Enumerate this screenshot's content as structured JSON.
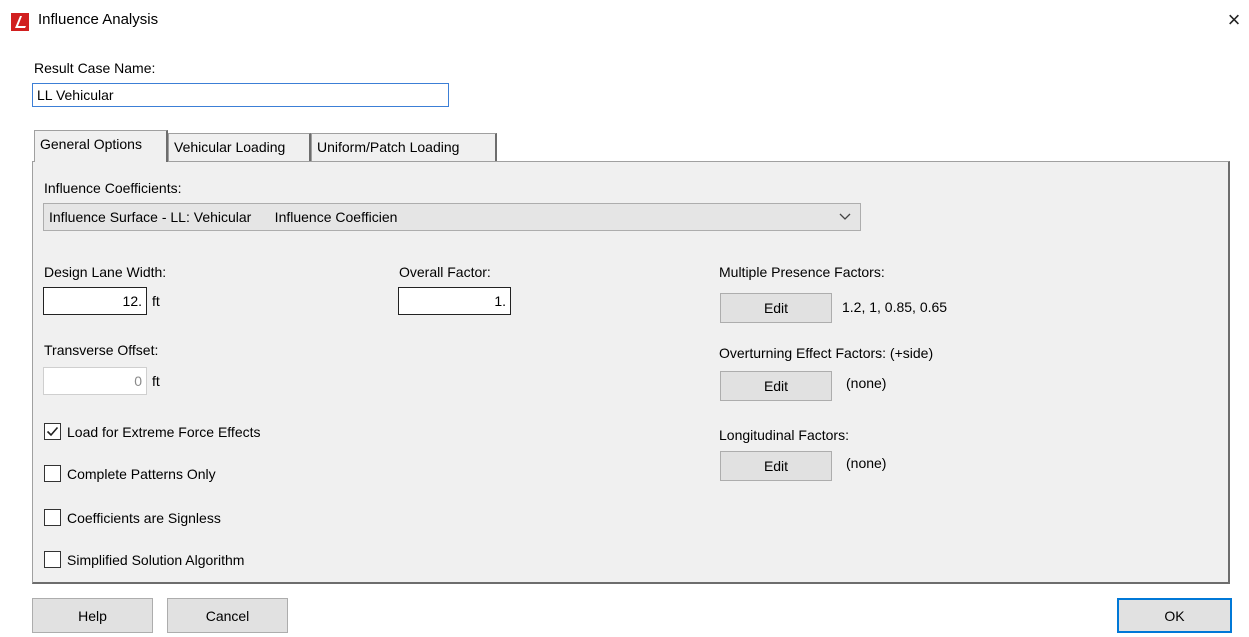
{
  "window": {
    "title": "Influence Analysis",
    "close_label": "×"
  },
  "result_case": {
    "label": "Result Case Name:",
    "value": "LL Vehicular"
  },
  "tabs": [
    {
      "label": "General Options",
      "active": true
    },
    {
      "label": "Vehicular Loading",
      "active": false
    },
    {
      "label": "Uniform/Patch Loading",
      "active": false
    }
  ],
  "general": {
    "influence_label": "Influence Coefficients:",
    "influence_value": "Influence Surface - LL: Vehicular      Influence Coefficien",
    "lane_width_label": "Design Lane Width:",
    "lane_width_value": "12.",
    "lane_width_unit": "ft",
    "overall_factor_label": "Overall Factor:",
    "overall_factor_value": "1.",
    "transverse_offset_label": "Transverse Offset:",
    "transverse_offset_value": "0",
    "transverse_offset_unit": "ft",
    "checkboxes": [
      {
        "label": "Load for Extreme Force Effects",
        "checked": true
      },
      {
        "label": "Complete Patterns Only",
        "checked": false
      },
      {
        "label": "Coefficients are Signless",
        "checked": false
      },
      {
        "label": "Simplified Solution Algorithm",
        "checked": false
      }
    ],
    "multiple_presence_label": "Multiple Presence Factors:",
    "multiple_presence_value": "1.2, 1, 0.85, 0.65",
    "overturning_label": "Overturning Effect Factors: (+side)",
    "overturning_value": "(none)",
    "longitudinal_label": "Longitudinal Factors:",
    "longitudinal_value": "(none)",
    "edit_label": "Edit"
  },
  "footer": {
    "help_label": "Help",
    "cancel_label": "Cancel",
    "ok_label": "OK"
  },
  "colors": {
    "accent": "#0078d7",
    "icon_red": "#d11f1f"
  }
}
